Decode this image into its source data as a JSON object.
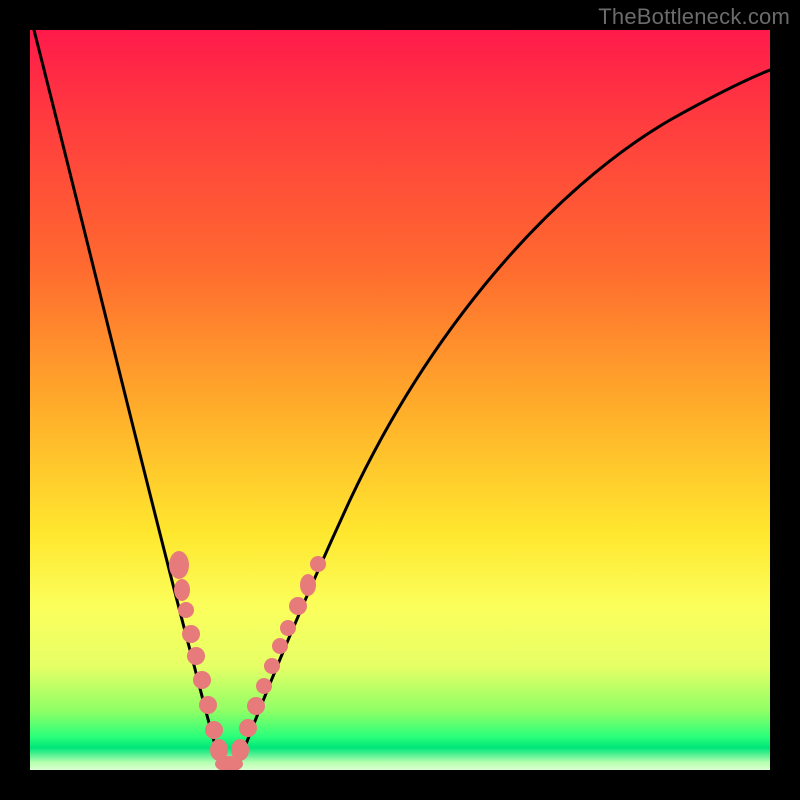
{
  "watermark": {
    "text": "TheBottleneck.com"
  },
  "chart_data": {
    "type": "line",
    "title": "",
    "xlabel": "",
    "ylabel": "",
    "xlim": [
      0,
      100
    ],
    "ylim": [
      0,
      100
    ],
    "grid": false,
    "series": [
      {
        "name": "bottleneck-curve",
        "x": [
          0,
          5,
          10,
          15,
          18,
          21,
          24,
          25,
          26,
          27,
          30,
          33,
          38,
          45,
          55,
          65,
          75,
          85,
          95,
          100
        ],
        "y": [
          100,
          80,
          60,
          40,
          25,
          12,
          3,
          0,
          0,
          3,
          10,
          20,
          35,
          50,
          65,
          75,
          82,
          87,
          90,
          92
        ]
      }
    ],
    "markers": {
      "name": "highlighted-points",
      "color": "#e77a7a",
      "points": [
        {
          "x": 19.0,
          "y": 30
        },
        {
          "x": 19.5,
          "y": 26
        },
        {
          "x": 20.4,
          "y": 22
        },
        {
          "x": 21.0,
          "y": 18
        },
        {
          "x": 21.8,
          "y": 14
        },
        {
          "x": 22.5,
          "y": 10
        },
        {
          "x": 23.2,
          "y": 6
        },
        {
          "x": 24.0,
          "y": 3
        },
        {
          "x": 24.8,
          "y": 1
        },
        {
          "x": 25.5,
          "y": 0
        },
        {
          "x": 26.3,
          "y": 0.5
        },
        {
          "x": 27.0,
          "y": 2
        },
        {
          "x": 28.0,
          "y": 6
        },
        {
          "x": 29.0,
          "y": 11
        },
        {
          "x": 30.0,
          "y": 15
        },
        {
          "x": 30.8,
          "y": 18
        },
        {
          "x": 31.5,
          "y": 21
        },
        {
          "x": 32.4,
          "y": 25
        },
        {
          "x": 33.5,
          "y": 30
        },
        {
          "x": 34.3,
          "y": 33
        }
      ]
    }
  }
}
